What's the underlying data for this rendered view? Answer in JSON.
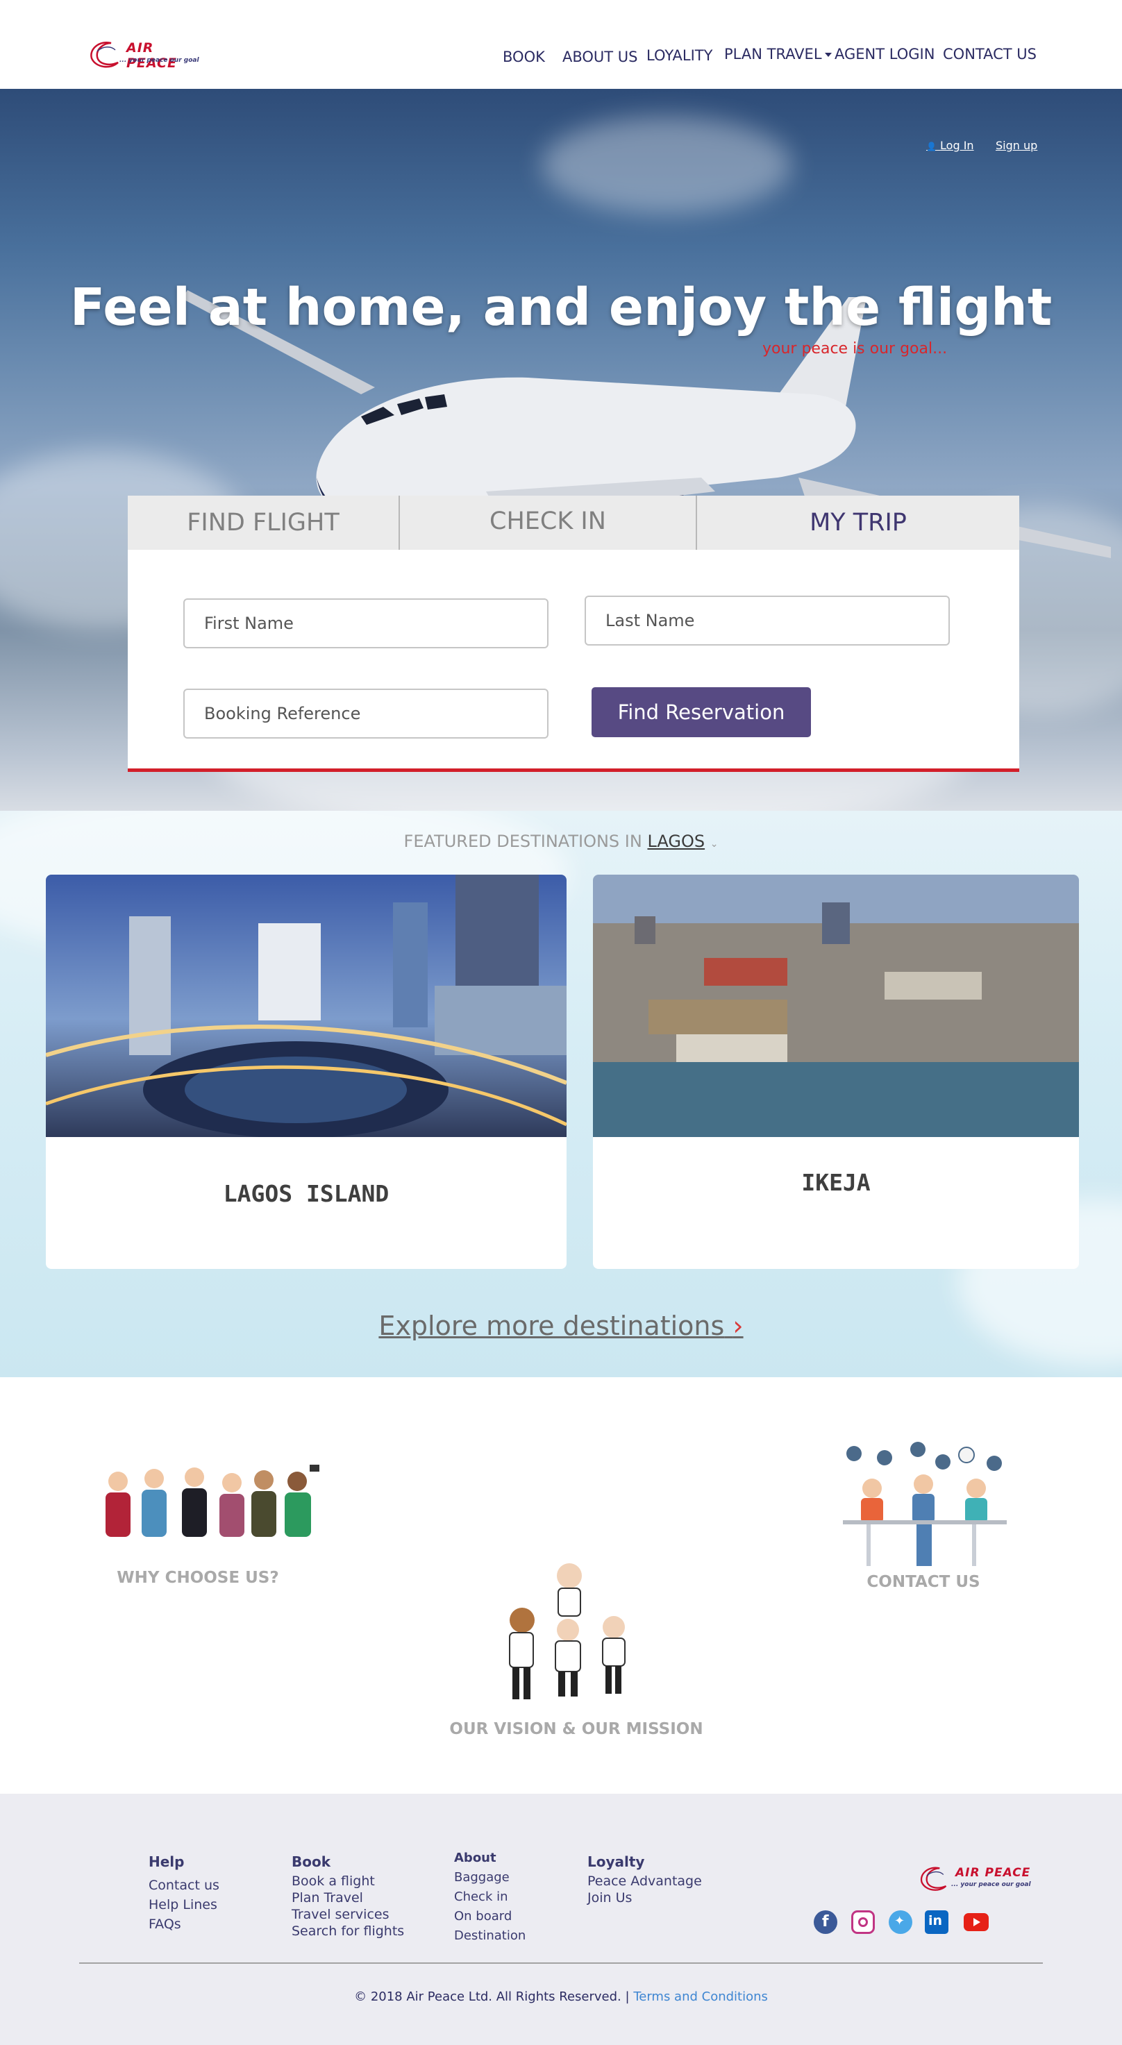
{
  "header": {
    "logo": {
      "brand": "AIR PEACE",
      "tagline": "... your peace our goal"
    },
    "nav": [
      {
        "label": "BOOK"
      },
      {
        "label": "ABOUT US"
      },
      {
        "label": "LOYALITY"
      },
      {
        "label": "PLAN TRAVEL"
      },
      {
        "label": "AGENT LOGIN"
      },
      {
        "label": "CONTACT US"
      }
    ]
  },
  "hero": {
    "login": "Log In",
    "signup": "Sign up",
    "title": "Feel at home, and enjoy the flight",
    "subtitle": "your peace is our goal..."
  },
  "booking": {
    "tabs": [
      {
        "label": "FIND FLIGHT"
      },
      {
        "label": "CHECK IN"
      },
      {
        "label": "MY TRIP"
      }
    ],
    "active_tab": "MY TRIP",
    "first_name_placeholder": "First Name",
    "last_name_placeholder": "Last Name",
    "booking_ref_placeholder": "Booking Reference",
    "submit_label": "Find Reservation"
  },
  "featured": {
    "heading": "FEATURED DESTINATIONS IN",
    "city": "LAGOS",
    "cards": [
      {
        "title": "LAGOS ISLAND"
      },
      {
        "title": "IKEJA"
      }
    ],
    "explore": "Explore more destinations"
  },
  "info": {
    "why": "WHY CHOOSE US?",
    "vision": "OUR VISION & OUR MISSION",
    "contact": "CONTACT US"
  },
  "footer": {
    "help": {
      "title": "Help",
      "links": [
        "Contact us",
        "Help Lines",
        "FAQs"
      ]
    },
    "book": {
      "title": "Book",
      "links": [
        "Book a flight",
        "Plan Travel",
        "Travel services",
        "Search for flights"
      ]
    },
    "about": {
      "title": "About",
      "links": [
        "Baggage",
        "Check in",
        "On board",
        "Destination"
      ]
    },
    "loyalty": {
      "title": "Loyalty",
      "links": [
        "Peace Advantage",
        "Join Us"
      ]
    },
    "social": [
      "facebook-icon",
      "instagram-icon",
      "twitter-icon",
      "linkedin-icon",
      "youtube-icon"
    ],
    "copyright": "© 2018 Air Peace Ltd. All Rights Reserved. |",
    "terms": "Terms and Conditions"
  },
  "colors": {
    "brand_red": "#c8102e",
    "brand_navy": "#2b2b62",
    "button_purple": "#574a83",
    "terms_blue": "#3f86d2"
  }
}
